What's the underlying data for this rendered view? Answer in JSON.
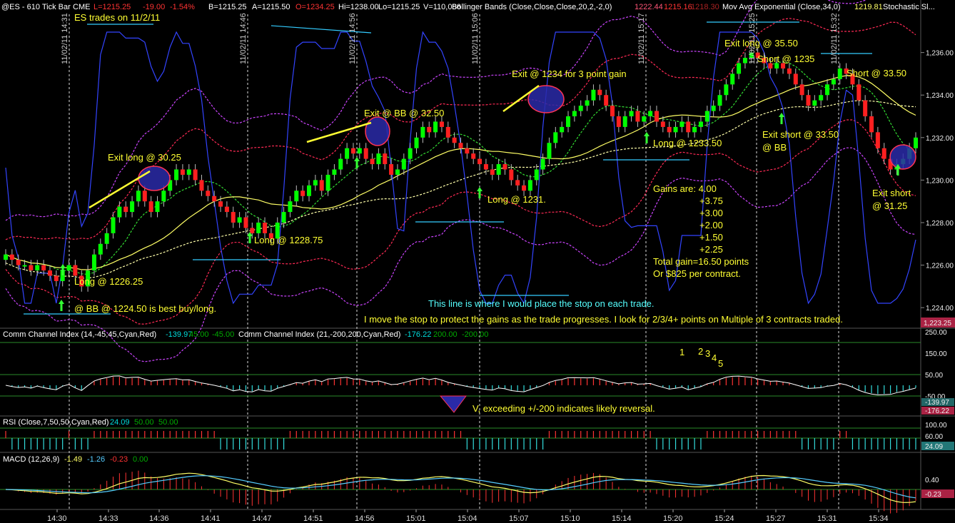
{
  "header": {
    "symbol": "@ES - 610 Tick Bar",
    "exchange": "CME",
    "last": "L=1215.25",
    "change": "-19.00",
    "pct": "-1.54%",
    "bid": "B=1215.25",
    "ask": "A=1215.50",
    "open": "O=1234.25",
    "high": "Hi=1238.00",
    "low": "Lo=1215.25",
    "volume": "V=110,086",
    "bb_label": "Bollinger Bands (Close,Close,Close,20,2,-2,0)",
    "bb_v1": "1222.44",
    "bb_v2": "1215.16",
    "bb_v3": "1218.30",
    "ema_label": "Mov Avg Exponential (Close,34,0)",
    "ema_v": "1219.81",
    "stoch_label": "Stochastic Sl..."
  },
  "colors": {
    "up": "#00ff00",
    "down": "#ff2020",
    "annotation": "#ffff33",
    "cyan": "#55ffff",
    "magenta": "#cc44ff",
    "stop_line": "#33ccff",
    "circle": "#2a2aa8",
    "red_band": "#ff2a55",
    "yellow_band": "#ffff66"
  },
  "annotations": {
    "title": "ES trades on 11/2/11",
    "exit_long_3025": "Exit long @ 30.25",
    "exit_bb_3250": "Exit @ BB @ 32.50",
    "exit_1234": "Exit @ 1234 for 3 point gain",
    "exit_long_3550": "Exit long @ 35.50",
    "short_1235": "Short @ 1235",
    "short_3350": "Short @ 33.50",
    "exit_short_3350": "Exit short @ 33.50",
    "at_bb": "@ BB",
    "long_123350": "Long @ 1233.50",
    "long_1231": "Long @ 1231.",
    "long_122875": "Long @ 1228.75",
    "long_122625": "Long @ 1226.25",
    "bb_best": "@ BB @ 1224.50 is best buy/long.",
    "exit_short_3125_a": "Exit short",
    "exit_short_3125_b": "@ 31.25",
    "gains_title": "Gains are: 4.00",
    "gains": [
      "+3.75",
      "+3.00",
      "+2.00",
      "+1.50",
      "+2.25"
    ],
    "total": "Total gain=16.50 points",
    "per_contract": "Or $825 per contract.",
    "stop_note": "This line is where I would place the stop on each trade.",
    "move_stop": "I move the stop to protect the gains as the trade progresses. I look for 2/3/4+ points on Multiple of 3 contracts traded.",
    "cci_note": "V, exceeding +/-200 indicates likely reversal.",
    "cci_nums": [
      "1",
      "2",
      "3",
      "4",
      "5"
    ]
  },
  "date_markers": [
    "11/02/11 14:31",
    "11/02/11 14:46",
    "11/02/11 14:56",
    "11/02/11 15:06",
    "11/02/11 15:17",
    "11/02/11 15:25",
    "11/02/11 15:32"
  ],
  "indicators": {
    "cci": {
      "label": "Comm Channel Index (14,-45,45,Cyan,Red)",
      "v1": "-139.97",
      "v2": "45.00",
      "v3": "-45.00",
      "label2": "Comm Channel Index (21,-200,200,Cyan,Red)",
      "w1": "-176.22",
      "w2": "200.00",
      "w3": "-200.00",
      "axis": [
        "250.00",
        "150.00",
        "50.00",
        "-50.00"
      ],
      "last1": "-139.97",
      "last2": "-176.22"
    },
    "rsi": {
      "label": "RSI (Close,7,50,50,Cyan,Red)",
      "v1": "24.09",
      "v2": "50.00",
      "v3": "50.00",
      "axis": [
        "100.00",
        "60.00"
      ],
      "last": "24.09"
    },
    "macd": {
      "label": "MACD (12,26,9)",
      "v1": "-1.49",
      "v2": "-1.26",
      "v3": "-0.23",
      "v4": "0.00",
      "axis": [
        "0.40"
      ],
      "last": "-0.23"
    }
  },
  "chart_data": {
    "type": "candlestick",
    "y_axis_labels": [
      "1,236.00",
      "1,234.00",
      "1,232.00",
      "1,230.00",
      "1,228.00",
      "1,226.00",
      "1,224.00"
    ],
    "ylim": [
      1223.2,
      1237.8
    ],
    "last_price_tag": "1,223.25",
    "x_tick_labels": [
      "14:30",
      "14:33",
      "14:36",
      "14:41",
      "14:47",
      "14:51",
      "14:56",
      "15:01",
      "15:04",
      "15:07",
      "15:10",
      "15:14",
      "15:20",
      "15:24",
      "15:27",
      "15:31",
      "15:34"
    ],
    "bar_count": 145,
    "close": [
      1226.5,
      1226.25,
      1226.0,
      1226.0,
      1225.75,
      1226.0,
      1225.75,
      1225.5,
      1225.25,
      1225.75,
      1226.0,
      1225.5,
      1225.0,
      1225.75,
      1226.5,
      1227.0,
      1227.5,
      1228.25,
      1228.75,
      1228.5,
      1229.0,
      1229.5,
      1229.0,
      1228.5,
      1229.0,
      1229.5,
      1230.0,
      1230.5,
      1230.25,
      1230.5,
      1230.0,
      1229.5,
      1229.25,
      1229.0,
      1228.75,
      1228.5,
      1228.0,
      1228.25,
      1227.75,
      1227.5,
      1228.0,
      1227.5,
      1227.25,
      1228.0,
      1228.5,
      1229.0,
      1229.5,
      1229.25,
      1229.75,
      1230.0,
      1229.5,
      1230.25,
      1230.5,
      1231.0,
      1231.5,
      1231.25,
      1231.5,
      1231.0,
      1230.75,
      1231.25,
      1230.75,
      1230.25,
      1230.5,
      1231.0,
      1231.5,
      1232.0,
      1232.5,
      1232.25,
      1232.75,
      1232.5,
      1232.0,
      1231.75,
      1231.5,
      1231.25,
      1231.0,
      1230.75,
      1230.5,
      1230.25,
      1230.75,
      1230.5,
      1230.0,
      1229.75,
      1229.5,
      1230.0,
      1230.5,
      1231.0,
      1231.75,
      1232.25,
      1232.5,
      1233.0,
      1233.25,
      1233.5,
      1233.75,
      1234.25,
      1234.0,
      1233.5,
      1233.0,
      1232.5,
      1233.0,
      1233.25,
      1232.75,
      1233.0,
      1233.25,
      1232.75,
      1232.5,
      1232.25,
      1232.5,
      1232.75,
      1232.25,
      1232.5,
      1232.75,
      1233.25,
      1233.5,
      1234.0,
      1234.5,
      1235.0,
      1235.5,
      1235.75,
      1236.0,
      1235.75,
      1235.5,
      1235.25,
      1235.5,
      1235.25,
      1235.0,
      1234.5,
      1234.0,
      1233.5,
      1233.75,
      1234.0,
      1234.5,
      1234.75,
      1235.25,
      1235.0,
      1234.5,
      1233.75,
      1233.0,
      1232.25,
      1231.5,
      1231.0,
      1230.5,
      1230.75,
      1231.0,
      1231.5,
      1232.0
    ]
  }
}
